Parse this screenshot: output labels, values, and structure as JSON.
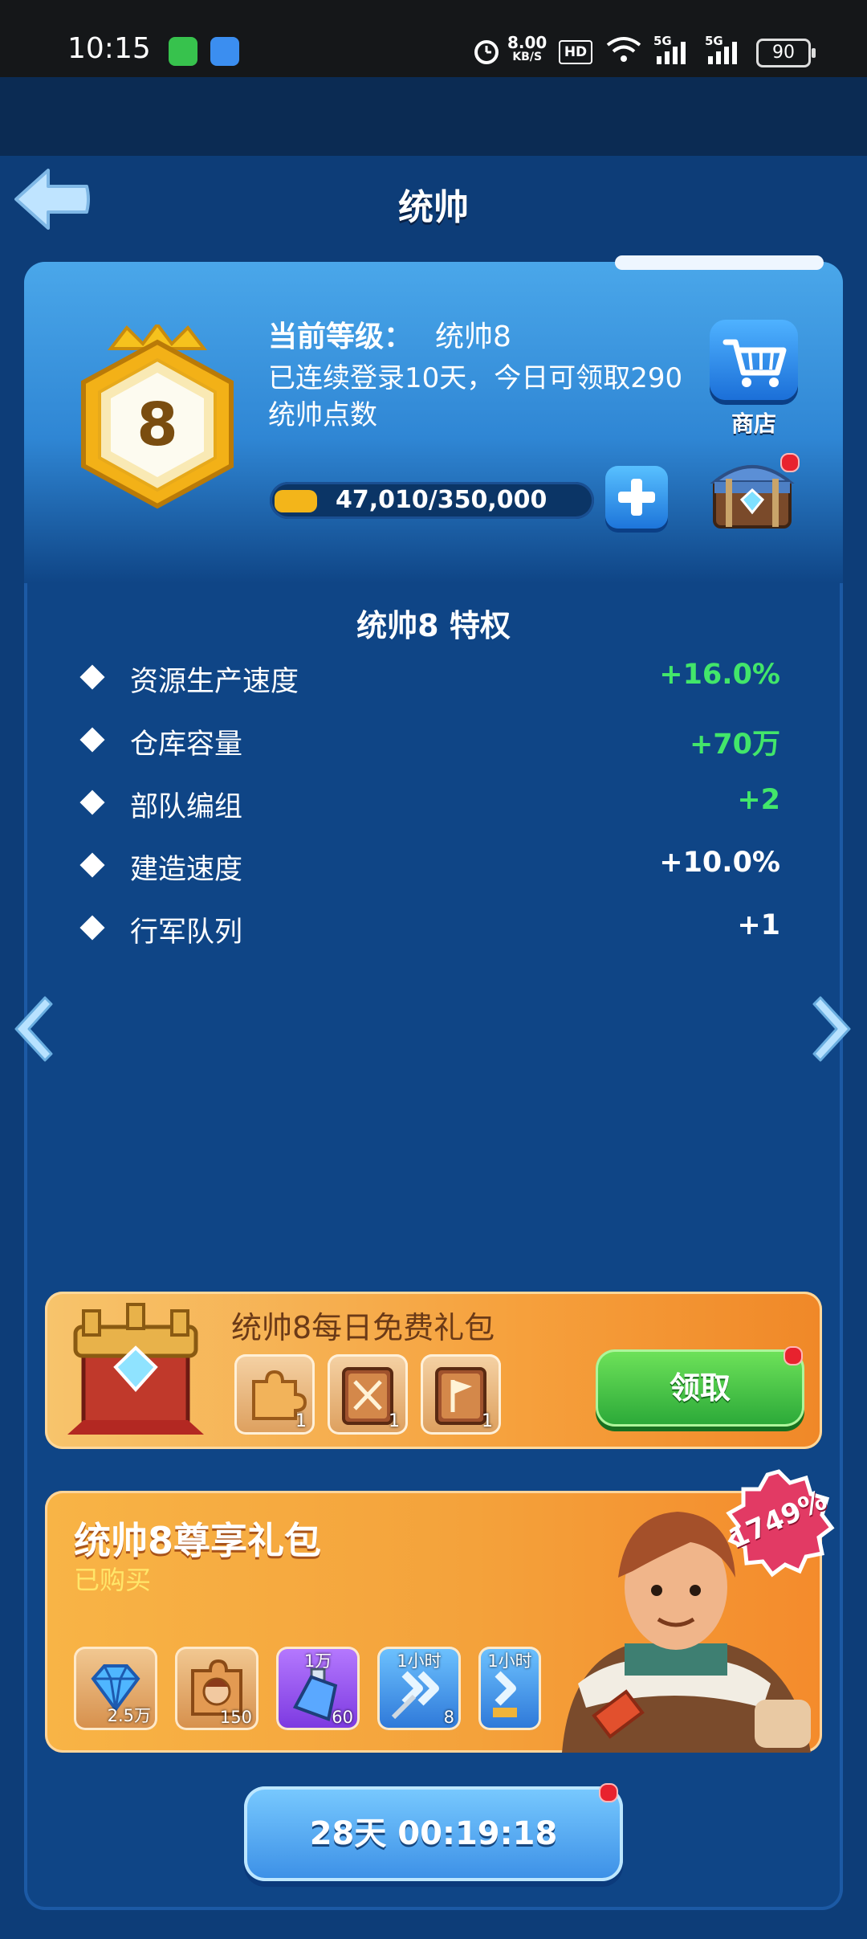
{
  "status_bar": {
    "time": "10:15",
    "net_speed": "8.00",
    "net_speed_unit": "KB/S",
    "hd": "HD",
    "signal_1": "5G",
    "signal_2": "5G",
    "battery": "90"
  },
  "header": {
    "title": "统帅"
  },
  "level_card": {
    "badge_level": "8",
    "level_label": "当前等级：",
    "level_value": "统帅8",
    "login_text": "已连续登录10天，今日可领取290统帅点数",
    "progress_text": "47,010/350,000",
    "progress_fraction": 0.1343,
    "shop_label": "商店"
  },
  "privileges": {
    "title": "统帅8 特权",
    "rows": [
      {
        "name": "资源生产速度",
        "value": "+16.0%",
        "color": "#42e66a"
      },
      {
        "name": "仓库容量",
        "value": "+70万",
        "color": "#42e66a"
      },
      {
        "name": "部队编组",
        "value": "+2",
        "color": "#42e66a"
      },
      {
        "name": "建造速度",
        "value": "+10.0%",
        "color": "#ffffff"
      },
      {
        "name": "行军队列",
        "value": "+1",
        "color": "#ffffff"
      }
    ]
  },
  "daily_pack": {
    "title": "统帅8每日免费礼包",
    "items": [
      {
        "icon": "puzzle-piece-icon",
        "count": "1"
      },
      {
        "icon": "sword-book-icon",
        "count": "1"
      },
      {
        "icon": "flag-book-icon",
        "count": "1"
      }
    ],
    "claim_label": "领取"
  },
  "exclusive_pack": {
    "title": "统帅8尊享礼包",
    "status": "已购买",
    "discount": "1749%",
    "items": [
      {
        "icon": "diamond-icon",
        "top": "",
        "count": "2.5万"
      },
      {
        "icon": "hero-fragment-icon",
        "top": "",
        "count": "150"
      },
      {
        "icon": "potion-bottle-icon",
        "top": "1万",
        "count": "60"
      },
      {
        "icon": "speedup-sword-icon",
        "top": "1小时",
        "count": "8"
      },
      {
        "icon": "speedup-build-icon",
        "top": "1小时",
        "count": ""
      }
    ]
  },
  "timer": {
    "label": "28天 00:19:18"
  },
  "colors": {
    "panel": "#0f4586",
    "accent_green": "#42e66a",
    "gold": "#f3b51a"
  }
}
